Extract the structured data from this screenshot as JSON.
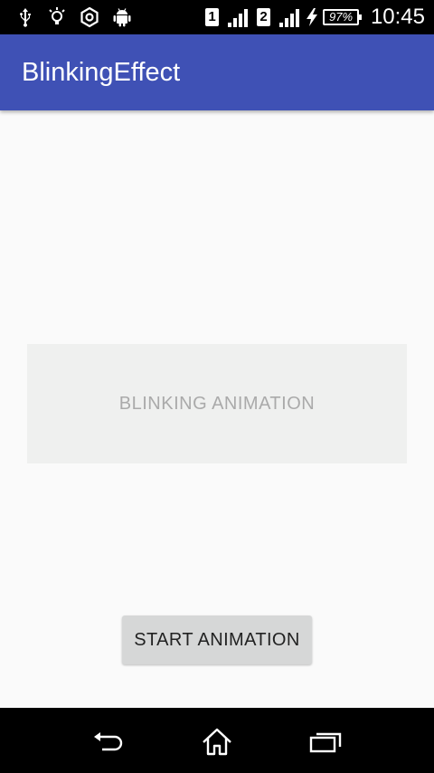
{
  "status_bar": {
    "icons": [
      "usb-icon",
      "lightbulb-icon",
      "settings-icon",
      "android-icon"
    ],
    "sim1_label": "1",
    "sim2_label": "2",
    "battery_percent": "97%",
    "time": "10:45"
  },
  "app_bar": {
    "title": "BlinkingEffect"
  },
  "main": {
    "blink_text": "BLINKING ANIMATION",
    "start_button_label": "START ANIMATION"
  },
  "nav_bar": {
    "icons": [
      "back-icon",
      "home-icon",
      "recents-icon"
    ]
  },
  "colors": {
    "app_bar": "#3f51b5",
    "background": "#fafafa",
    "blink_box": "#eff0ef",
    "button": "#d6d7d7"
  }
}
